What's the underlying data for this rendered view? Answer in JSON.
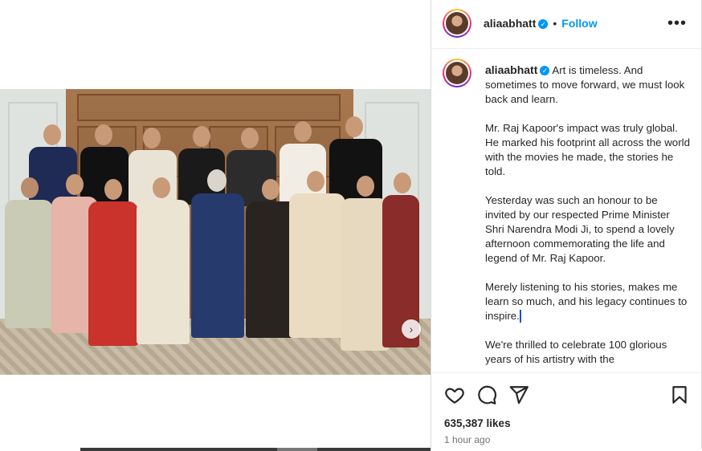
{
  "post": {
    "username": "aliaabhatt",
    "follow_label": "Follow",
    "separator": "•",
    "more_label": "•••",
    "caption": {
      "paragraphs": [
        "Art is timeless. And sometimes to move forward, we must look back and learn.",
        "Mr. Raj Kapoor's impact was truly global. He marked his footprint all across the world with the movies he made, the stories he told.",
        "Yesterday was such an honour to be invited by our respected Prime Minister Shri Narendra Modi Ji, to spend a lovely afternoon commemorating the life and legend of Mr. Raj Kapoor.",
        "Merely listening to his stories, makes me learn so much, and his legacy continues to inspire.",
        "We're thrilled to celebrate 100 glorious years of his artistry with the"
      ]
    },
    "likes": "635,387 likes",
    "time_ago": "1 hour ago"
  },
  "icons": {
    "like": "heart-icon",
    "comment": "comment-icon",
    "share": "send-icon",
    "save": "bookmark-icon",
    "next": "chevron-right-icon",
    "verified": "verified-badge-icon"
  },
  "colors": {
    "accent": "#0095f6",
    "text": "#262626",
    "muted": "#737373"
  }
}
